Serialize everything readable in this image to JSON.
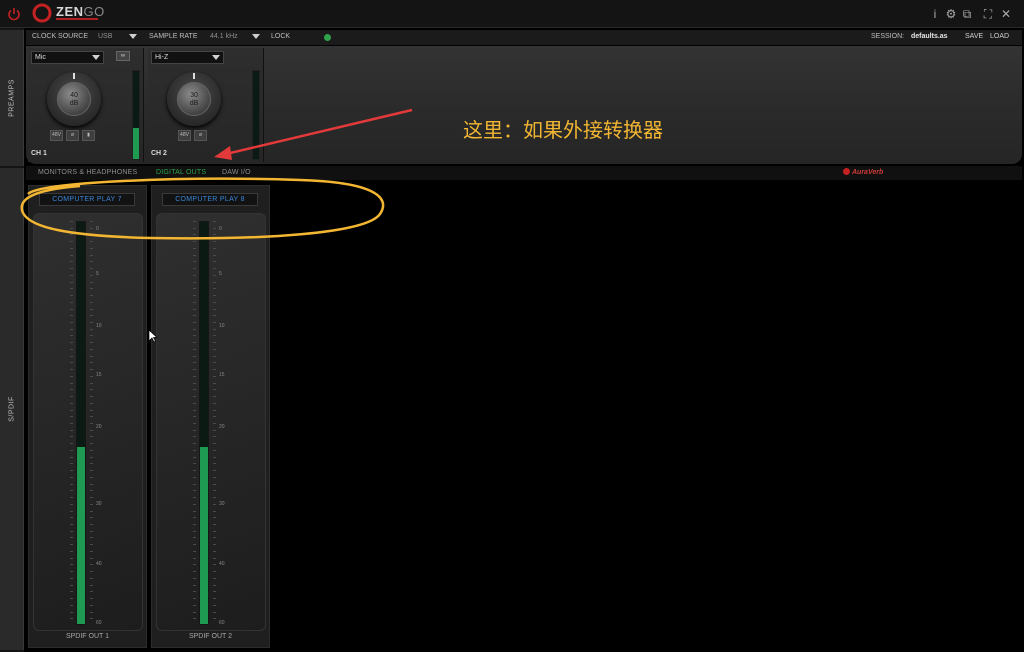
{
  "window": {
    "brand": "ZEN",
    "brand_suffix": "GO",
    "controls": [
      "i",
      "⚙",
      "⧉",
      "⛶",
      "✕"
    ]
  },
  "sidebar": {
    "tabs": [
      {
        "label": "PREAMPS"
      },
      {
        "label": "S/PDIF"
      }
    ]
  },
  "status": {
    "clock_source_label": "CLOCK SOURCE",
    "clock_source_value": "USB",
    "sample_rate_label": "SAMPLE RATE",
    "sample_rate_value": "44.1 kHz",
    "lock_label": "LOCK",
    "lock_color": "#2fa34b",
    "session_label": "SESSION:",
    "session_value": "defaults.as",
    "save_label": "SAVE",
    "load_label": "LOAD"
  },
  "preamps": {
    "link_label": "∞",
    "channels": [
      {
        "input": "Mic",
        "gain": "40",
        "unit": "dB",
        "name": "CH 1",
        "buttons": [
          "48V",
          "ø",
          "▮"
        ],
        "level": 0.35
      },
      {
        "input": "Hi-Z",
        "gain": "30",
        "unit": "dB",
        "name": "CH 2",
        "buttons": [
          "48V",
          "ø"
        ],
        "level": 0
      }
    ]
  },
  "annotation": {
    "text": "这里：如果外接转换器",
    "color": "#f2b632"
  },
  "tabs": {
    "items": [
      {
        "label": "MONITORS & HEADPHONES",
        "active": false
      },
      {
        "label": "DIGITAL OUTS",
        "active": true
      },
      {
        "label": "DAW I/O",
        "active": false
      }
    ],
    "plugin": "AuraVerb"
  },
  "outputs": {
    "scale_ticks": [
      "0",
      "5",
      "10",
      "15",
      "20",
      "30",
      "40",
      "60"
    ],
    "strips": [
      {
        "source": "COMPUTER PLAY 7",
        "name": "SPDIF OUT 1",
        "level": 0.44
      },
      {
        "source": "COMPUTER PLAY 8",
        "name": "SPDIF OUT 2",
        "level": 0.44
      }
    ]
  },
  "colors": {
    "accent_green": "#1f9a52",
    "source_blue": "#3a86d8",
    "brand_red": "#c42222",
    "highlight": "#f2b632",
    "arrow": "#e23a3a"
  }
}
